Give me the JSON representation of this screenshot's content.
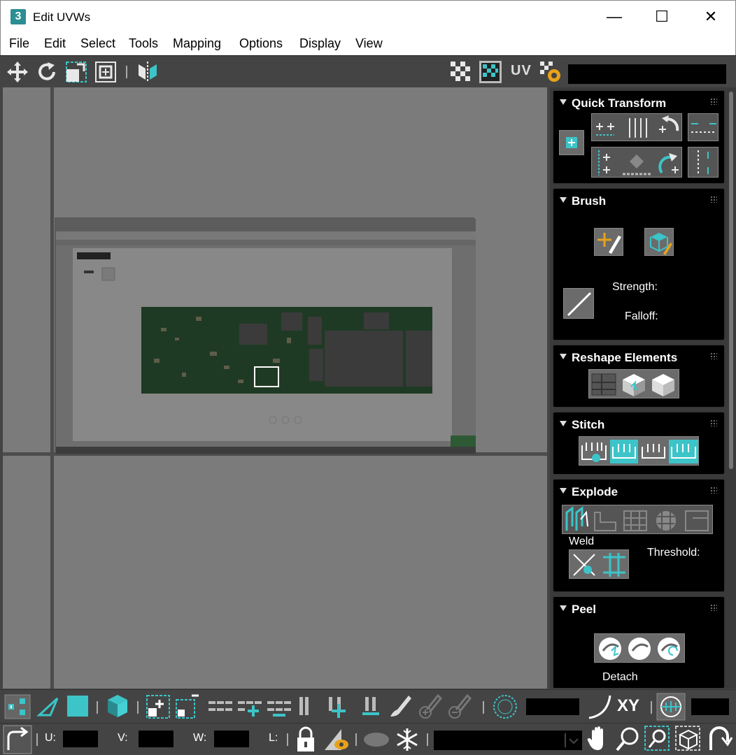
{
  "window": {
    "title": "Edit UVWs",
    "app_icon_text": "3",
    "minimize": "—",
    "maximize": "☐",
    "close": "✕"
  },
  "menu": [
    "File",
    "Edit",
    "Select",
    "Tools",
    "Mapping",
    "Options",
    "Display",
    "View"
  ],
  "toolbar": {
    "uv_label": "UV"
  },
  "panel": {
    "quick_transform": {
      "title": "Quick Transform"
    },
    "brush": {
      "title": "Brush",
      "strength_label": "Strength:",
      "falloff_label": "Falloff:"
    },
    "reshape": {
      "title": "Reshape Elements"
    },
    "stitch": {
      "title": "Stitch"
    },
    "explode": {
      "title": "Explode",
      "weld_label": "Weld",
      "threshold_label": "Threshold:"
    },
    "peel": {
      "title": "Peel",
      "detach_label": "Detach"
    }
  },
  "bottom": {
    "xy_label": "XY",
    "u_label": "U:",
    "v_label": "V:",
    "w_label": "W:",
    "l_label": "L:"
  },
  "colors": {
    "accent_teal": "#3cc4c8",
    "panel_bg": "#000000",
    "toolbar_bg": "#444444",
    "viewport_bg": "#7b7b7b"
  }
}
